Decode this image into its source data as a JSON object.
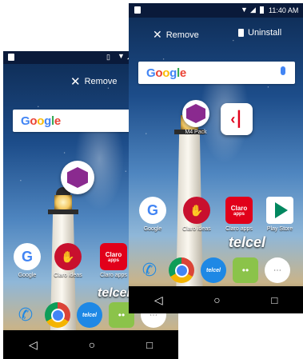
{
  "back_screen": {
    "remove_label": "Remove",
    "search_logo": "Google",
    "apps": [
      {
        "label": "Google",
        "icon": "google-icon"
      },
      {
        "label": "Claro ideas",
        "icon": "claro-ideas-icon"
      },
      {
        "label": "Claro apps",
        "icon": "claro-apps-icon"
      }
    ],
    "brand": "telcel",
    "dock": [
      "phone-icon",
      "chrome-icon",
      "telcel-icon",
      "messages-icon",
      "app-drawer-icon"
    ]
  },
  "front_screen": {
    "status_time": "11:40 AM",
    "remove_label": "Remove",
    "uninstall_label": "Uninstall",
    "search_logo": "Google",
    "dragged_app": {
      "label": "M4 Pack",
      "icon": "m4-pack-icon"
    },
    "drop_target_icon": "headset-arrow-icon",
    "apps": [
      {
        "label": "Google",
        "icon": "google-icon"
      },
      {
        "label": "Claro ideas",
        "icon": "claro-ideas-icon"
      },
      {
        "label": "Claro apps",
        "icon": "claro-apps-icon"
      },
      {
        "label": "Play Store",
        "icon": "play-store-icon"
      }
    ],
    "brand": "telcel",
    "claro_text": "Claro",
    "claro_sub": "apps",
    "dock": [
      "phone-icon",
      "chrome-icon",
      "telcel-icon",
      "messages-icon",
      "app-drawer-icon"
    ]
  },
  "nav": [
    "back-icon",
    "home-icon",
    "recents-icon"
  ],
  "colors": {
    "status": "#0a1a3a",
    "claro_red": "#e1001a",
    "m4_purple": "#8a2a8f"
  }
}
